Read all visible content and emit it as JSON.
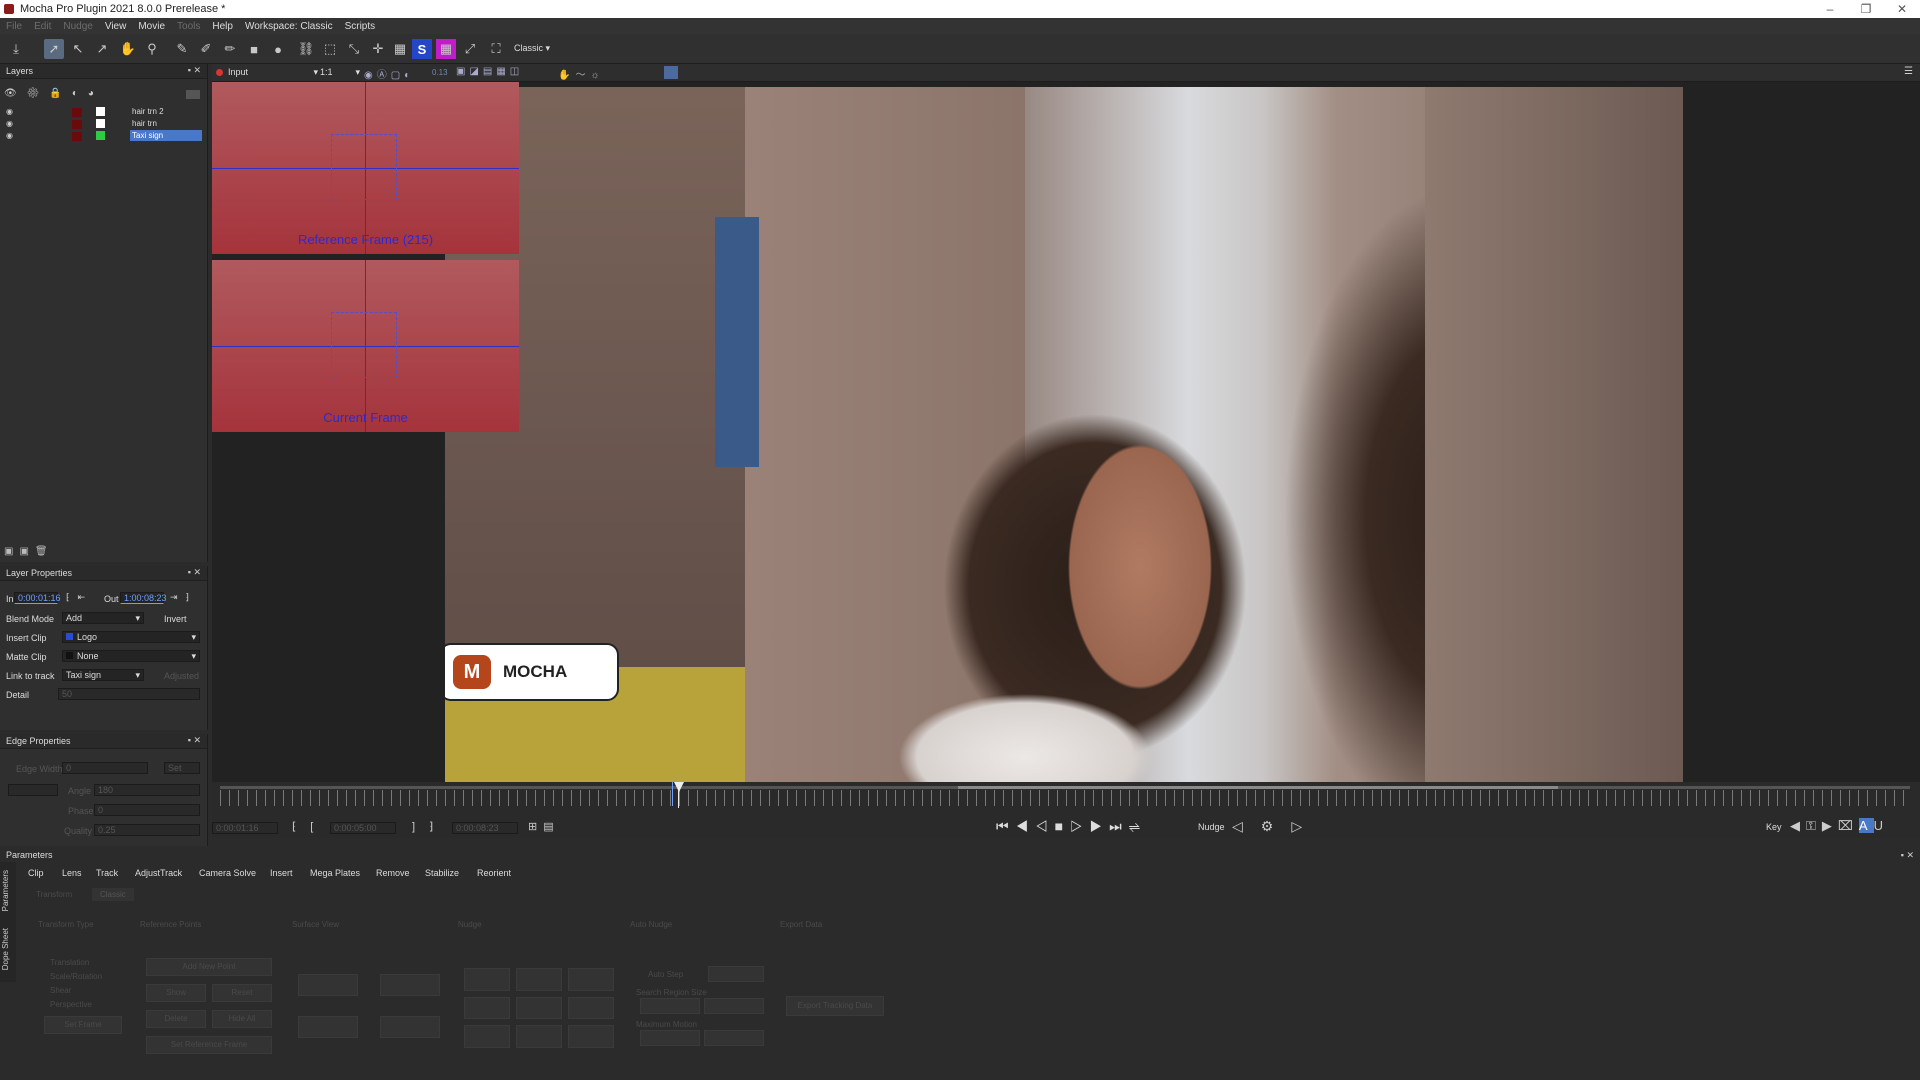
{
  "window": {
    "title": "Mocha Pro Plugin 2021 8.0.0 Prerelease *"
  },
  "menu": {
    "items": [
      {
        "label": "File",
        "enabled": false
      },
      {
        "label": "Edit",
        "enabled": false
      },
      {
        "label": "Nudge",
        "enabled": false
      },
      {
        "label": "View",
        "enabled": true
      },
      {
        "label": "Movie",
        "enabled": true
      },
      {
        "label": "Tools",
        "enabled": false
      },
      {
        "label": "Help",
        "enabled": true
      },
      {
        "label": "Workspace: Classic",
        "enabled": true
      },
      {
        "label": "Scripts",
        "enabled": true
      }
    ]
  },
  "toolbar": {
    "workspace_select": "Classic",
    "s_label": "S"
  },
  "viewer_bar": {
    "clip": "Input",
    "zoom": "1:1",
    "value": "0.13"
  },
  "layers_panel": {
    "title": "Layers",
    "layers": [
      {
        "name": "hair trn 2",
        "color": "#ffffff",
        "selected": false
      },
      {
        "name": "hair trn",
        "color": "#ffffff",
        "selected": false
      },
      {
        "name": "Taxi sign",
        "color": "#2ecc40",
        "selected": true
      }
    ]
  },
  "layer_properties": {
    "title": "Layer Properties",
    "in_label": "In",
    "in_value": "0:00:01:16",
    "out_label": "Out",
    "out_value": "1:00:08:23",
    "blend_mode_label": "Blend Mode",
    "blend_mode": "Add",
    "invert_label": "Invert",
    "insert_clip_label": "Insert Clip",
    "insert_clip": "Logo",
    "matte_clip_label": "Matte Clip",
    "matte_clip": "None",
    "link_label": "Link to track",
    "link_value": "Taxi sign",
    "adjusted_label": "Adjusted",
    "detail_label": "Detail",
    "detail_value": "50"
  },
  "edge_properties": {
    "title": "Edge Properties",
    "edge_width_label": "Edge Width",
    "edge_width": "0",
    "set_label": "Set",
    "angle_label": "Angle",
    "angle": "180",
    "phase_label": "Phase",
    "phase": "0",
    "quality_label": "Quality",
    "quality": "0.25"
  },
  "viewer": {
    "reference_label": "Reference Frame (215)",
    "current_label": "Current Frame",
    "logo_text": "MOCHA",
    "logo_letter": "M"
  },
  "transport": {
    "nudge_label": "Nudge",
    "key_label": "Key",
    "tc1": "0:00:01:16",
    "tc2": "0:00:05:00",
    "tc3": "0:00:08:23"
  },
  "parameters": {
    "title": "Parameters",
    "side_tabs": [
      "Parameters",
      "Dope Sheet"
    ],
    "tabs": [
      "Clip",
      "Lens",
      "Track",
      "AdjustTrack",
      "Camera Solve",
      "Insert",
      "Mega Plates",
      "Remove",
      "Stabilize",
      "Reorient"
    ],
    "subtabs": [
      "Transform",
      "Classic"
    ],
    "sections": [
      "Transform Type",
      "Reference Points",
      "Surface View",
      "Nudge",
      "Auto Nudge",
      "Export Data"
    ],
    "transform_types": [
      "Translation",
      "Scale/Rotation",
      "Shear",
      "Perspective"
    ],
    "set_frame": "Set Frame",
    "ref_buttons": [
      "Add New Point",
      "Show",
      "Reset",
      "Delete",
      "Hide All",
      "Set Reference Frame"
    ],
    "auto_step": "Auto Step",
    "search_region": "Search Region Size",
    "max_motion": "Maximum Motion",
    "export_button": "Export Tracking Data"
  }
}
